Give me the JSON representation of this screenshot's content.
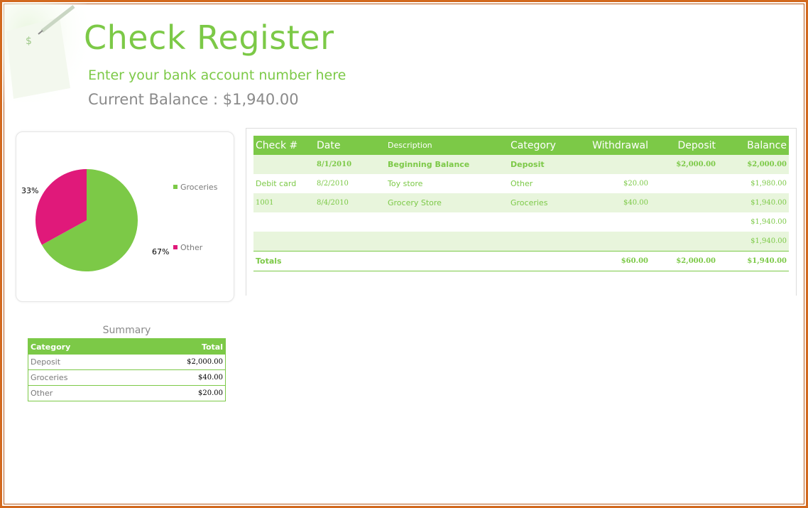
{
  "header": {
    "title": "Check Register",
    "account_placeholder": "Enter your bank account number here",
    "balance_text": "Current Balance : $1,940.00"
  },
  "colors": {
    "accent_green": "#7cc947",
    "band_green": "#e8f5dc",
    "pink": "#e0197a",
    "frame_orange": "#d2691e"
  },
  "chart_data": {
    "type": "pie",
    "categories": [
      "Groceries",
      "Other"
    ],
    "values": [
      67,
      33
    ],
    "data_labels": [
      "67%",
      "33%"
    ],
    "colors": [
      "#7cc947",
      "#e0197a"
    ],
    "legend": "right"
  },
  "summary": {
    "title": "Summary",
    "columns": [
      "Category",
      "Total"
    ],
    "rows": [
      {
        "category": "Deposit",
        "total": "$2,000.00"
      },
      {
        "category": "Groceries",
        "total": "$40.00"
      },
      {
        "category": "Other",
        "total": "$20.00"
      }
    ]
  },
  "register": {
    "columns": [
      "Check #",
      "Date",
      "Description",
      "Category",
      "Withdrawal",
      "Deposit",
      "Balance"
    ],
    "rows": [
      {
        "check": "",
        "date": "8/1/2010",
        "description": "Beginning Balance",
        "category": "Deposit",
        "withdrawal": "",
        "deposit": "$2,000.00",
        "balance": "$2,000.00"
      },
      {
        "check": "Debit card",
        "date": "8/2/2010",
        "description": "Toy store",
        "category": "Other",
        "withdrawal": "$20.00",
        "deposit": "",
        "balance": "$1,980.00"
      },
      {
        "check": "1001",
        "date": "8/4/2010",
        "description": "Grocery Store",
        "category": "Groceries",
        "withdrawal": "$40.00",
        "deposit": "",
        "balance": "$1,940.00"
      },
      {
        "check": "",
        "date": "",
        "description": "",
        "category": "",
        "withdrawal": "",
        "deposit": "",
        "balance": "$1,940.00"
      },
      {
        "check": "",
        "date": "",
        "description": "",
        "category": "",
        "withdrawal": "",
        "deposit": "",
        "balance": "$1,940.00"
      }
    ],
    "totals": {
      "label": "Totals",
      "withdrawal": "$60.00",
      "deposit": "$2,000.00",
      "balance": "$1,940.00"
    }
  }
}
